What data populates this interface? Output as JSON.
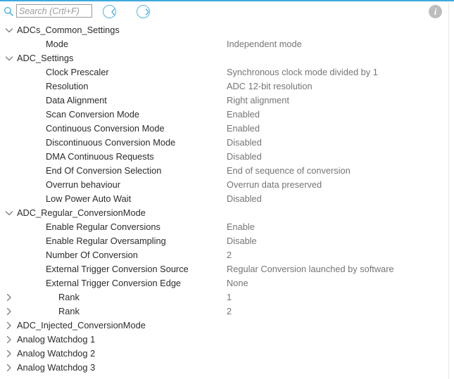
{
  "toolbar": {
    "search_placeholder": "Search (Crtl+F)",
    "search_value": "",
    "back_label": "Back",
    "forward_label": "Forward",
    "info_label": "i",
    "accent_color": "#4fb4e4",
    "top_border_color": "#3fa9dd",
    "info_icon_color": "#bdbdbd"
  },
  "tree": {
    "rows": [
      {
        "type": "group",
        "state": "expanded",
        "label": "ADCs_Common_Settings",
        "value": ""
      },
      {
        "type": "child",
        "state": "leaf",
        "label": "Mode",
        "value": "Independent mode"
      },
      {
        "type": "group",
        "state": "expanded",
        "label": "ADC_Settings",
        "value": ""
      },
      {
        "type": "child",
        "state": "leaf",
        "label": "Clock Prescaler",
        "value": "Synchronous clock mode divided by 1"
      },
      {
        "type": "child",
        "state": "leaf",
        "label": "Resolution",
        "value": "ADC 12-bit resolution"
      },
      {
        "type": "child",
        "state": "leaf",
        "label": "Data Alignment",
        "value": "Right alignment"
      },
      {
        "type": "child",
        "state": "leaf",
        "label": "Scan Conversion Mode",
        "value": "Enabled"
      },
      {
        "type": "child",
        "state": "leaf",
        "label": "Continuous Conversion Mode",
        "value": "Enabled"
      },
      {
        "type": "child",
        "state": "leaf",
        "label": "Discontinuous Conversion Mode",
        "value": "Disabled"
      },
      {
        "type": "child",
        "state": "leaf",
        "label": "DMA Continuous Requests",
        "value": "Disabled"
      },
      {
        "type": "child",
        "state": "leaf",
        "label": "End Of Conversion Selection",
        "value": "End of sequence of conversion"
      },
      {
        "type": "child",
        "state": "leaf",
        "label": "Overrun behaviour",
        "value": "Overrun data preserved"
      },
      {
        "type": "child",
        "state": "leaf",
        "label": "Low Power Auto Wait",
        "value": "Disabled"
      },
      {
        "type": "group",
        "state": "expanded",
        "label": "ADC_Regular_ConversionMode",
        "value": ""
      },
      {
        "type": "child",
        "state": "leaf",
        "label": "Enable Regular Conversions",
        "value": "Enable"
      },
      {
        "type": "child",
        "state": "leaf",
        "label": "Enable Regular Oversampling",
        "value": "Disable"
      },
      {
        "type": "child",
        "state": "leaf",
        "label": "Number Of Conversion",
        "value": "2"
      },
      {
        "type": "child",
        "state": "leaf",
        "label": "External Trigger Conversion Source",
        "value": "Regular Conversion launched by software"
      },
      {
        "type": "child",
        "state": "leaf",
        "label": "External Trigger Conversion Edge",
        "value": "None"
      },
      {
        "type": "subitem",
        "state": "collapsed",
        "label": "Rank",
        "value": "1"
      },
      {
        "type": "subitem",
        "state": "collapsed",
        "label": "Rank",
        "value": "2"
      },
      {
        "type": "group",
        "state": "collapsed",
        "label": "ADC_Injected_ConversionMode",
        "value": ""
      },
      {
        "type": "group",
        "state": "collapsed",
        "label": "Analog Watchdog 1",
        "value": ""
      },
      {
        "type": "group",
        "state": "collapsed",
        "label": "Analog Watchdog 2",
        "value": ""
      },
      {
        "type": "group",
        "state": "collapsed",
        "label": "Analog Watchdog 3",
        "value": ""
      }
    ]
  }
}
